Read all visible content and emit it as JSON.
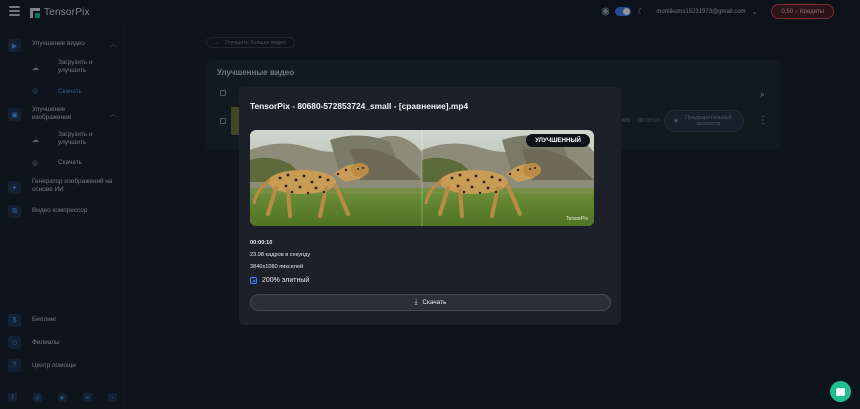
{
  "topbar": {
    "app_name": "TensorPix",
    "email": "montikoms15231973@gmail.com",
    "credits_label": "0,50 ○ Кредиты"
  },
  "sidebar": {
    "sections": [
      {
        "label": "Улучшение видео",
        "icon": "video-icon",
        "sub": [
          {
            "label": "Загрузить и улучшить",
            "icon": "cloud-upload-icon",
            "active": false
          },
          {
            "label": "Скачать",
            "icon": "check-circle-icon",
            "active": true
          }
        ]
      },
      {
        "label": "Улучшение изображения",
        "icon": "image-icon",
        "sub": [
          {
            "label": "Загрузить и улучшить",
            "icon": "cloud-upload-icon",
            "active": false
          },
          {
            "label": "Скачать",
            "icon": "check-circle-icon",
            "active": false
          }
        ]
      },
      {
        "label": "Генератор изображений на основе ИИ",
        "icon": "magic-wand-icon"
      },
      {
        "label": "Видео компрессор",
        "icon": "compress-icon"
      }
    ],
    "bottom": [
      {
        "label": "Биллинг",
        "icon": "dollar-icon"
      },
      {
        "label": "Филиалы",
        "icon": "handshake-icon"
      },
      {
        "label": "Центр помощи",
        "icon": "help-icon"
      }
    ],
    "socials": [
      "facebook-icon",
      "instagram-icon",
      "youtube-icon",
      "linkedin-icon",
      "tiktok-icon"
    ]
  },
  "main": {
    "back_button": "Улучшить больше видео",
    "card_title": "Улучшенные видео",
    "row": {
      "size": "MB",
      "duration": "00:00:10",
      "preview_label": "Предварительный просмотр"
    }
  },
  "modal": {
    "title": "TensorPix - 80680-572853724_small - [сравнение].mp4",
    "badge": "УЛУЧШЕННЫЙ",
    "watermark": "TensorPix",
    "duration": "00:00:10",
    "fps": "23.98 кадров в секунду",
    "resolution": "3840x1080 пикселей",
    "elite": "200% элитный",
    "download_label": "Скачать"
  },
  "colors": {
    "accent": "#3a82f6",
    "credits_border": "#e04a4a",
    "chat": "#1fbf8f"
  }
}
